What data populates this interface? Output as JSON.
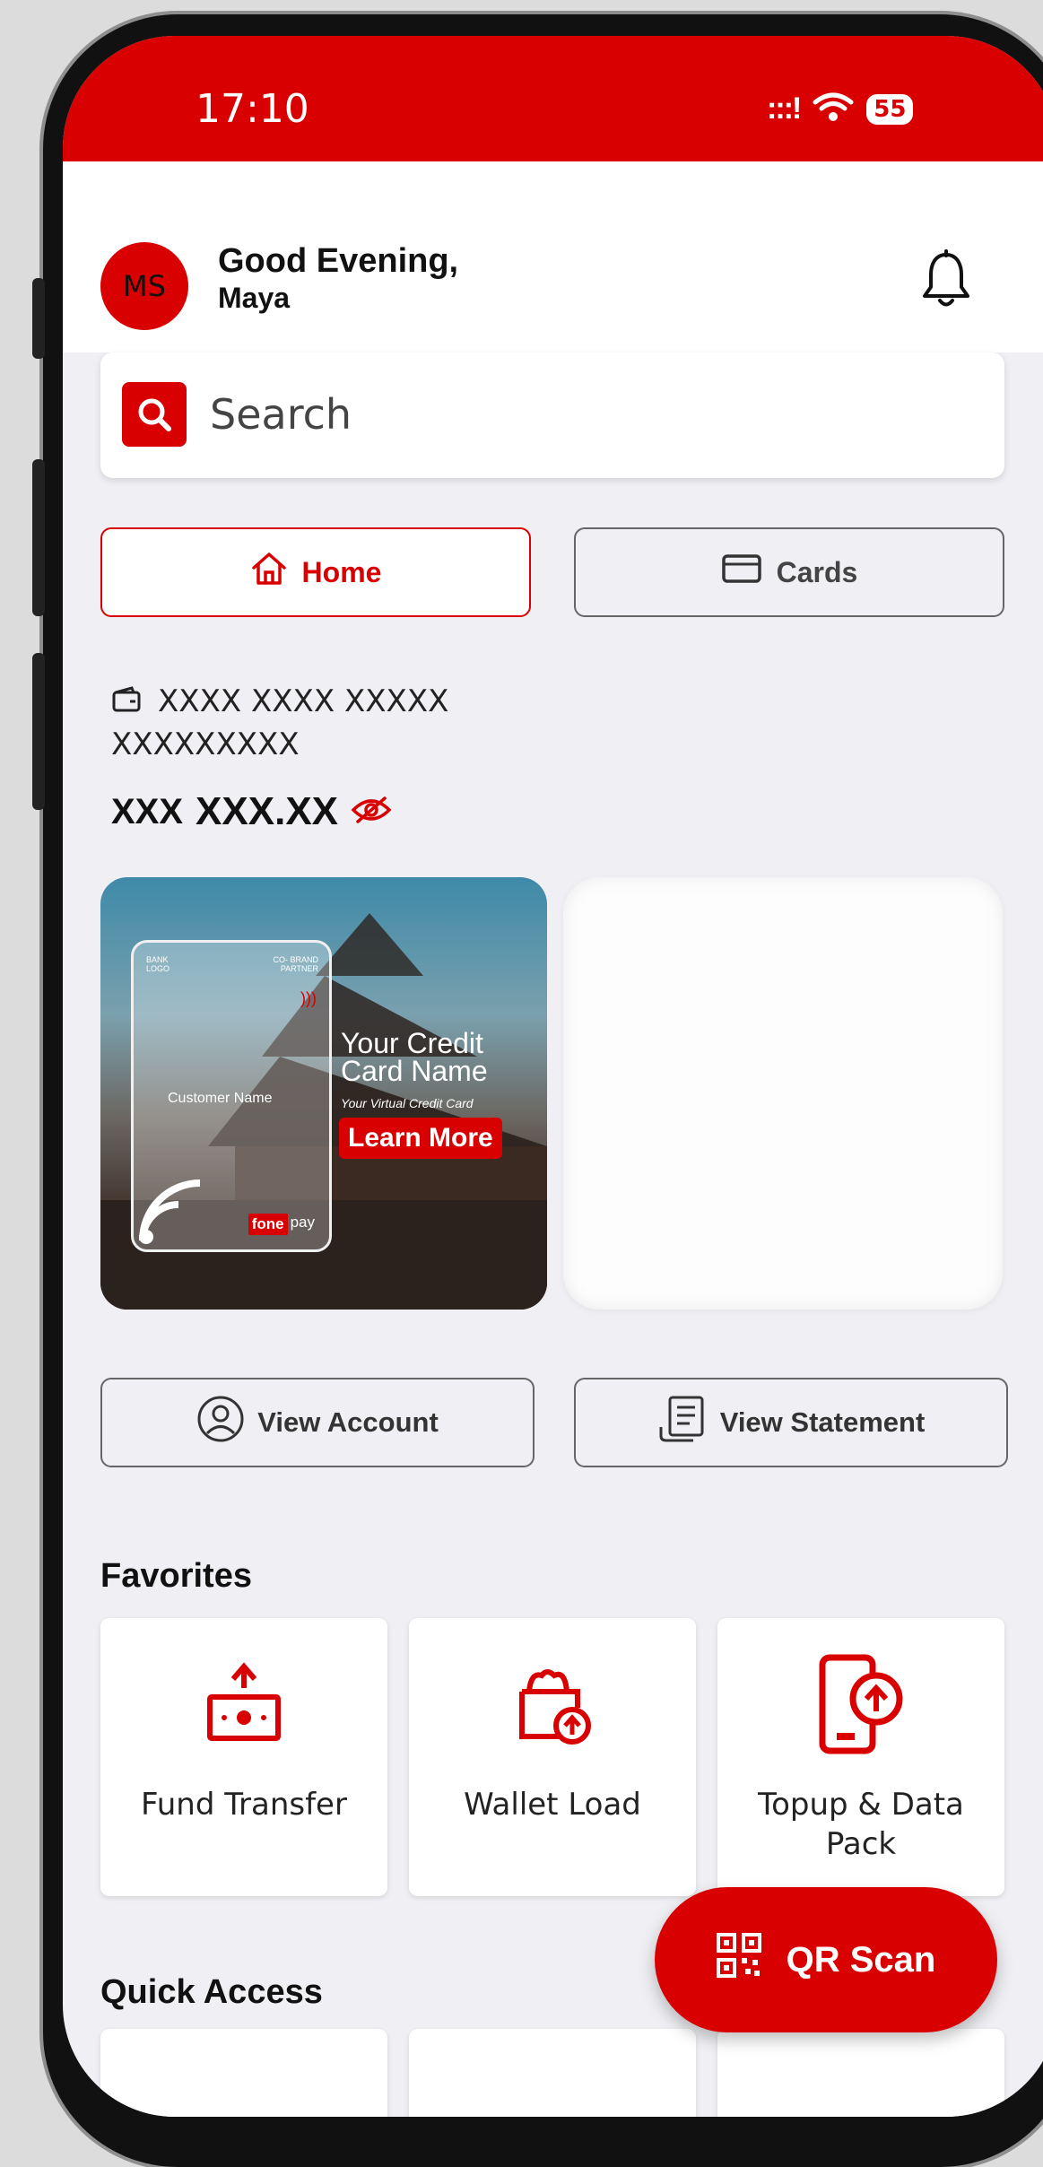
{
  "status_bar": {
    "time": "17:10",
    "signal": ":::!",
    "battery": "55"
  },
  "header": {
    "avatar_initials": "MS",
    "greeting": "Good Evening,",
    "user_name": "Maya"
  },
  "search": {
    "placeholder": "Search"
  },
  "tabs": [
    {
      "label": "Home",
      "active": true
    },
    {
      "label": "Cards",
      "active": false
    }
  ],
  "account": {
    "number_line1": "XXXX XXXX XXXXX",
    "number_line2": "XXXXXXXXX",
    "currency": "XXX",
    "balance": "XXX.XX"
  },
  "banner": {
    "bank_logo": "BANK\nLOGO",
    "co_brand": "CO- BRAND\nPARTNER",
    "card_customer": "Customer Name",
    "title": "Your Credit\nCard Name",
    "subtitle": "Your Virtual Credit Card",
    "cta": "Learn More",
    "brand_left": "fone",
    "brand_right": "pay"
  },
  "actions": {
    "view_account": "View Account",
    "view_statement": "View Statement"
  },
  "favorites": {
    "title": "Favorites",
    "items": [
      {
        "label": "Fund Transfer",
        "icon": "fund-transfer-icon"
      },
      {
        "label": "Wallet Load",
        "icon": "wallet-load-icon"
      },
      {
        "label": "Topup & Data Pack",
        "icon": "topup-icon"
      }
    ]
  },
  "quick_access": {
    "title": "Quick Access"
  },
  "fab": {
    "label": "QR Scan"
  },
  "colors": {
    "primary": "#d80000",
    "background": "#f0f0f4"
  }
}
